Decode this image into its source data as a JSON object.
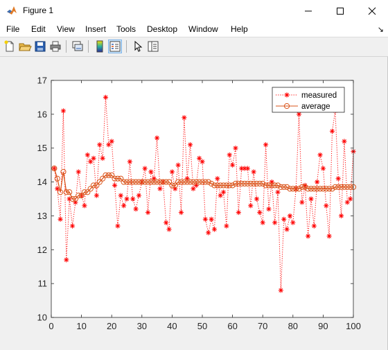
{
  "window": {
    "title": "Figure 1",
    "controls": {
      "minimize": "minimize",
      "maximize": "maximize",
      "close": "close"
    }
  },
  "menu": {
    "items": [
      "File",
      "Edit",
      "View",
      "Insert",
      "Tools",
      "Desktop",
      "Window",
      "Help"
    ],
    "overflow_arrow": "↘"
  },
  "toolbar": {
    "buttons": [
      {
        "icon": "new-figure-icon",
        "label": "New Figure"
      },
      {
        "icon": "open-file-icon",
        "label": "Open File"
      },
      {
        "icon": "save-icon",
        "label": "Save Figure"
      },
      {
        "icon": "print-icon",
        "label": "Print Figure"
      },
      {
        "icon": "link-plot-icon",
        "label": "Link Plot"
      },
      {
        "icon": "colorbar-icon",
        "label": "Insert Colorbar"
      },
      {
        "icon": "legend-icon",
        "label": "Insert Legend",
        "pressed": true
      },
      {
        "icon": "pointer-icon",
        "label": "Edit Plot"
      },
      {
        "icon": "property-inspector-icon",
        "label": "Open Property Inspector"
      }
    ]
  },
  "chart_data": {
    "type": "line",
    "xlim": [
      0,
      100
    ],
    "ylim": [
      10,
      17
    ],
    "xticks": [
      "0",
      "10",
      "20",
      "30",
      "40",
      "50",
      "60",
      "70",
      "80",
      "90",
      "100"
    ],
    "yticks": [
      "10",
      "11",
      "12",
      "13",
      "14",
      "15",
      "16",
      "17"
    ],
    "grid": false,
    "legend_position": "top-right",
    "x": [
      1,
      2,
      3,
      4,
      5,
      6,
      7,
      8,
      9,
      10,
      11,
      12,
      13,
      14,
      15,
      16,
      17,
      18,
      19,
      20,
      21,
      22,
      23,
      24,
      25,
      26,
      27,
      28,
      29,
      30,
      31,
      32,
      33,
      34,
      35,
      36,
      37,
      38,
      39,
      40,
      41,
      42,
      43,
      44,
      45,
      46,
      47,
      48,
      49,
      50,
      51,
      52,
      53,
      54,
      55,
      56,
      57,
      58,
      59,
      60,
      61,
      62,
      63,
      64,
      65,
      66,
      67,
      68,
      69,
      70,
      71,
      72,
      73,
      74,
      75,
      76,
      77,
      78,
      79,
      80,
      81,
      82,
      83,
      84,
      85,
      86,
      87,
      88,
      89,
      90,
      91,
      92,
      93,
      94,
      95,
      96,
      97,
      98,
      99,
      100
    ],
    "series": [
      {
        "name": "measured",
        "color": "#ff0000",
        "marker": "asterisk",
        "line": "dotted",
        "values": [
          14.4,
          13.8,
          12.9,
          16.1,
          11.7,
          13.5,
          12.7,
          13.4,
          14.3,
          13.6,
          13.3,
          14.8,
          14.6,
          14.7,
          13.6,
          15.1,
          14.7,
          16.5,
          15.1,
          15.2,
          13.9,
          12.7,
          13.6,
          13.3,
          13.5,
          14.6,
          13.5,
          13.2,
          13.6,
          14.0,
          14.4,
          13.1,
          14.3,
          14.1,
          15.3,
          13.8,
          14.0,
          12.8,
          12.6,
          14.3,
          13.8,
          14.5,
          13.1,
          15.9,
          14.1,
          15.1,
          13.8,
          13.9,
          14.7,
          14.6,
          12.9,
          12.5,
          12.9,
          12.6,
          14.1,
          13.6,
          13.7,
          12.7,
          14.8,
          14.5,
          15.0,
          13.1,
          14.4,
          14.4,
          14.4,
          13.3,
          14.3,
          13.5,
          13.1,
          12.8,
          15.1,
          13.2,
          14.0,
          12.8,
          13.7,
          10.8,
          12.9,
          12.6,
          13.0,
          12.8,
          13.8,
          16.0,
          13.4,
          13.9,
          12.4,
          13.5,
          12.7,
          14.0,
          14.8,
          14.4,
          13.3,
          12.4,
          15.5,
          16.1,
          14.1,
          13.0,
          15.2,
          13.4,
          13.5,
          14.9
        ]
      },
      {
        "name": "average",
        "color": "#d95319",
        "marker": "circle",
        "line": "solid",
        "values": [
          14.4,
          14.1,
          13.7,
          14.3,
          13.7,
          13.7,
          13.5,
          13.5,
          13.6,
          13.6,
          13.7,
          13.7,
          13.8,
          13.9,
          13.9,
          14.0,
          14.1,
          14.2,
          14.2,
          14.2,
          14.1,
          14.1,
          14.1,
          14.0,
          14.0,
          14.0,
          14.0,
          14.0,
          14.0,
          14.0,
          14.0,
          14.0,
          14.0,
          14.0,
          14.0,
          14.0,
          14.0,
          14.0,
          14.0,
          13.9,
          13.9,
          14.0,
          14.0,
          14.0,
          14.0,
          14.0,
          14.0,
          14.0,
          14.0,
          14.0,
          14.0,
          14.0,
          13.95,
          13.9,
          13.9,
          13.9,
          13.9,
          13.9,
          13.9,
          13.9,
          13.95,
          13.95,
          13.95,
          13.95,
          13.95,
          13.95,
          13.95,
          13.95,
          13.95,
          13.95,
          13.9,
          13.9,
          13.9,
          13.9,
          13.9,
          13.85,
          13.85,
          13.85,
          13.8,
          13.8,
          13.8,
          13.8,
          13.85,
          13.85,
          13.8,
          13.8,
          13.8,
          13.8,
          13.8,
          13.8,
          13.8,
          13.8,
          13.8,
          13.85,
          13.85,
          13.85,
          13.85,
          13.85,
          13.85,
          13.85
        ]
      }
    ]
  }
}
